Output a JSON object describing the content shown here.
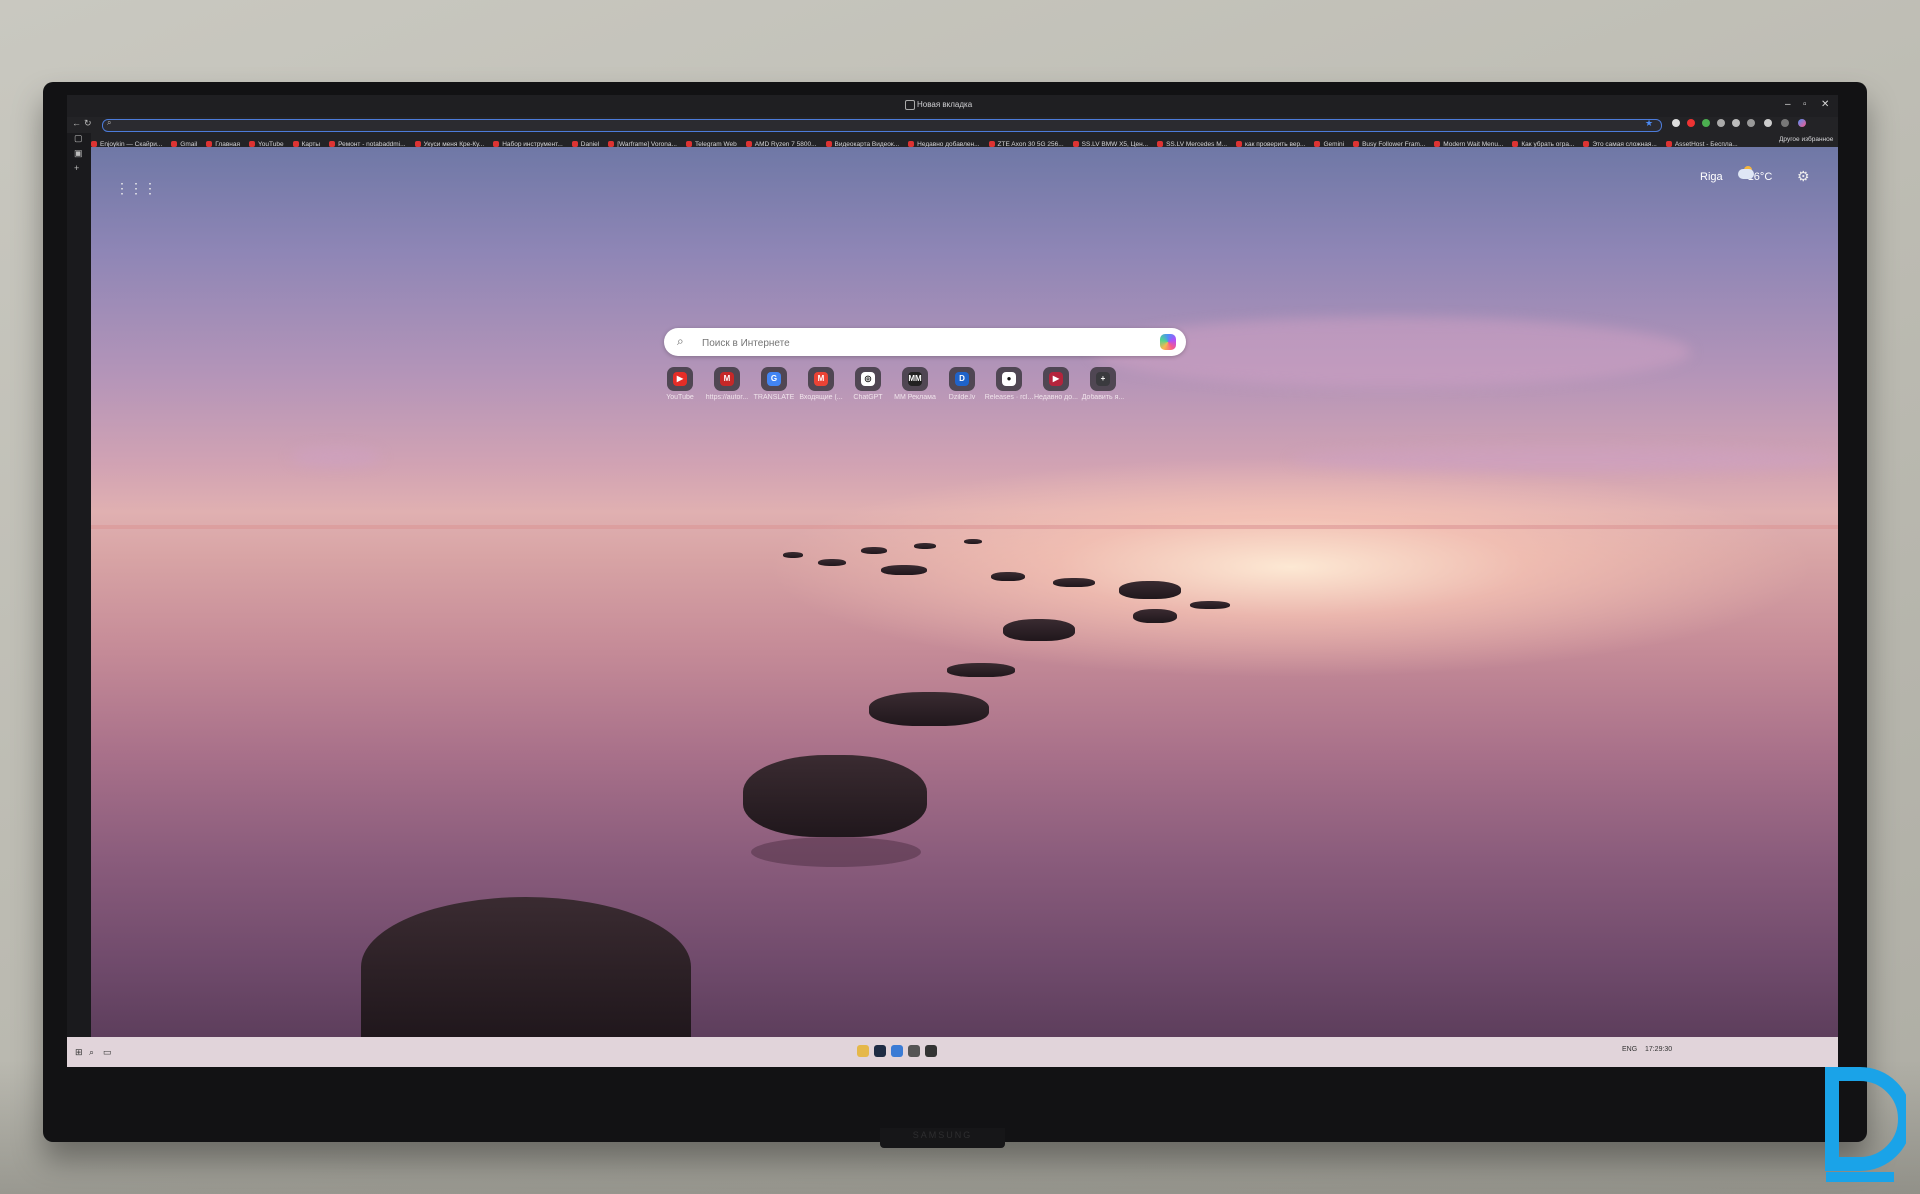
{
  "browser": {
    "tab_title": "Новая вкладка",
    "controls": {
      "minimize": "–",
      "maximize": "▫",
      "close": "✕"
    },
    "address_icon": "search-icon",
    "favorites_label": "Другое избранное"
  },
  "bookmarks": [
    "Enjoykin — Скайри...",
    "Gmail",
    "Главная",
    "YouTube",
    "Карты",
    "Ремонт - notabaddmi...",
    "Укуси меня Кре-Ку...",
    "Набор инструмент...",
    "Daniel",
    "[Warframe] Vorona...",
    "Telegram Web",
    "AMD Ryzen 7 5800...",
    "Видеокарта Видеок...",
    "Недавно добавлен...",
    "ZTE Axon 30 5G 256...",
    "SS.LV BMW X5, Цен...",
    "SS.LV Mercedes M...",
    "как проверить вер...",
    "Gemini",
    "Busy Follower Fram...",
    "Modern Wait Menu...",
    "Как убрать огра...",
    "Это самая сложная...",
    "AssetHost - Беспла..."
  ],
  "page": {
    "apps_icon": "grid-icon",
    "weather": {
      "city": "Riga",
      "temp": "16°C"
    },
    "settings_icon": "gear-icon",
    "search_placeholder": "Поиск в Интернете",
    "tiles": [
      {
        "label": "YouTube",
        "color": "#e52d27",
        "glyph": "▶"
      },
      {
        "label": "https://autor...",
        "color": "#c62828",
        "glyph": "M"
      },
      {
        "label": "TRANSLATE",
        "color": "#4285f4",
        "glyph": "G"
      },
      {
        "label": "Входящие (...",
        "color": "#ea4335",
        "glyph": "M"
      },
      {
        "label": "ChatGPT",
        "color": "#ffffff",
        "glyph": "◎"
      },
      {
        "label": "MM Реклама",
        "color": "#222222",
        "glyph": "MM"
      },
      {
        "label": "Dzilde.lv",
        "color": "#1f63c9",
        "glyph": "D"
      },
      {
        "label": "Releases · rcl...",
        "color": "#ffffff",
        "glyph": "●"
      },
      {
        "label": "Недавно до...",
        "color": "#b4243c",
        "glyph": "▶"
      },
      {
        "label": "Добавить я...",
        "color": "#3a3a3e",
        "glyph": "+"
      }
    ]
  },
  "taskbar": {
    "start_icon": "windows-icon",
    "search_icon": "search-icon",
    "tray_lang": "ENG",
    "time": "17:29:30"
  },
  "monitor": {
    "brand": "SAMSUNG"
  }
}
